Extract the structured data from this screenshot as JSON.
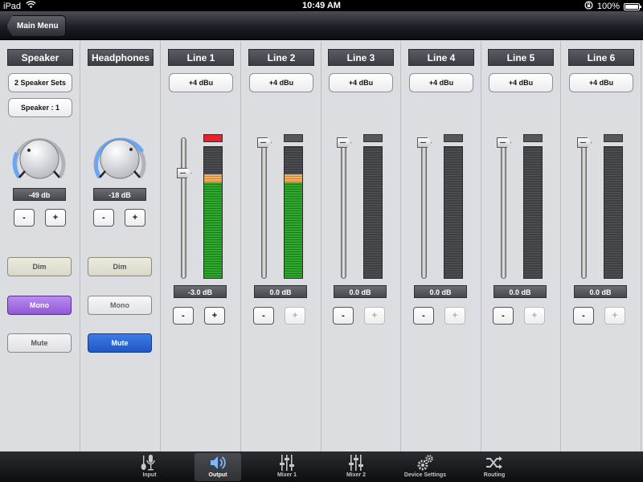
{
  "status_bar": {
    "carrier": "iPad",
    "time": "10:49 AM",
    "battery": "100%"
  },
  "nav": {
    "back_label": "Main Menu"
  },
  "speaker": {
    "title": "Speaker",
    "speaker_sets": "2 Speaker Sets",
    "speaker_select": "Speaker : 1",
    "level": "-49 db",
    "minus": "-",
    "plus": "+",
    "dim": "Dim",
    "mono": "Mono",
    "mute": "Mute",
    "mono_active": true,
    "mute_active": false
  },
  "headphones": {
    "title": "Headphones",
    "level": "-18 dB",
    "minus": "-",
    "plus": "+",
    "dim": "Dim",
    "mono": "Mono",
    "mute": "Mute",
    "mono_active": false,
    "mute_active": true
  },
  "lines": [
    {
      "title": "Line 1",
      "ref": "+4 dBu",
      "value": "-3.0 dB",
      "minus": "-",
      "plus": "+",
      "plus_enabled": true,
      "fader_pct": 0.75,
      "meter_pct": 0.78,
      "clip": true
    },
    {
      "title": "Line 2",
      "ref": "+4 dBu",
      "value": "0.0 dB",
      "minus": "-",
      "plus": "+",
      "plus_enabled": false,
      "fader_pct": 1.0,
      "meter_pct": 0.78,
      "clip": false
    },
    {
      "title": "Line 3",
      "ref": "+4 dBu",
      "value": "0.0 dB",
      "minus": "-",
      "plus": "+",
      "plus_enabled": false,
      "fader_pct": 1.0,
      "meter_pct": 0,
      "clip": false
    },
    {
      "title": "Line 4",
      "ref": "+4 dBu",
      "value": "0.0 dB",
      "minus": "-",
      "plus": "+",
      "plus_enabled": false,
      "fader_pct": 1.0,
      "meter_pct": 0,
      "clip": false
    },
    {
      "title": "Line 5",
      "ref": "+4 dBu",
      "value": "0.0 dB",
      "minus": "-",
      "plus": "+",
      "plus_enabled": false,
      "fader_pct": 1.0,
      "meter_pct": 0,
      "clip": false
    },
    {
      "title": "Line 6",
      "ref": "+4 dBu",
      "value": "0.0 dB",
      "minus": "-",
      "plus": "+",
      "plus_enabled": false,
      "fader_pct": 1.0,
      "meter_pct": 0,
      "clip": false
    }
  ],
  "tabs": [
    {
      "label": "Input",
      "icon": "microphone-guitar-icon",
      "active": false
    },
    {
      "label": "Output",
      "icon": "speaker-icon",
      "active": true
    },
    {
      "label": "Mixer 1",
      "icon": "faders-icon",
      "active": false
    },
    {
      "label": "Mixer 2",
      "icon": "faders-icon",
      "active": false
    },
    {
      "label": "Device Settings",
      "icon": "gears-icon",
      "active": false
    },
    {
      "label": "Routing",
      "icon": "shuffle-icon",
      "active": false
    }
  ],
  "colors": {
    "clip_red": "#e8202a",
    "meter_green": "#2faa2f",
    "meter_orange": "#f1b162",
    "mono_purple": "#9158d6",
    "mute_blue": "#1e58c4",
    "knob_ring": "#6aa6f2"
  }
}
